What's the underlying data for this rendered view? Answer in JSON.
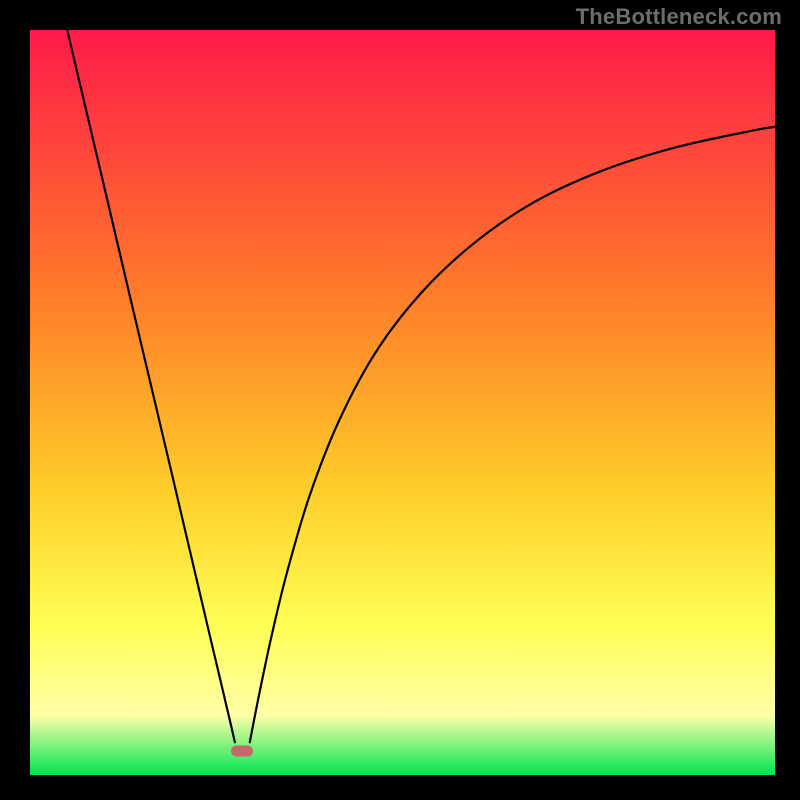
{
  "watermark": "TheBottleneck.com",
  "colors": {
    "marker_fill": "#c8676a",
    "black": "#000000",
    "grad_top": "#ff1a4a",
    "grad_mid1": "#ff7a2a",
    "grad_mid2": "#ffcf2a",
    "grad_yellow": "#ffff55",
    "grad_lightyellow": "#ffffa8",
    "grad_green": "#00e552"
  },
  "chart_data": {
    "type": "line",
    "title": "",
    "xlabel": "",
    "ylabel": "",
    "xlim": [
      0,
      100
    ],
    "ylim": [
      0,
      100
    ],
    "series": [
      {
        "name": "left-branch",
        "x": [
          5.0,
          7.0,
          10.0,
          13.0,
          16.0,
          19.0,
          22.0,
          24.0,
          25.8,
          27.0,
          27.5
        ],
        "y": [
          100.0,
          91.5,
          78.8,
          66.0,
          53.3,
          40.6,
          27.8,
          19.3,
          11.7,
          6.6,
          4.4
        ]
      },
      {
        "name": "right-branch",
        "x": [
          29.5,
          30.0,
          31.0,
          32.5,
          34.5,
          37.5,
          41.5,
          46.5,
          52.5,
          59.5,
          67.5,
          76.5,
          86.5,
          97.0,
          100.0
        ],
        "y": [
          4.4,
          7.0,
          12.0,
          19.0,
          27.2,
          37.4,
          47.6,
          56.9,
          64.7,
          71.3,
          76.8,
          81.0,
          84.2,
          86.5,
          87.0
        ]
      }
    ],
    "marker": {
      "x": 28.5,
      "y": 3.2
    }
  }
}
